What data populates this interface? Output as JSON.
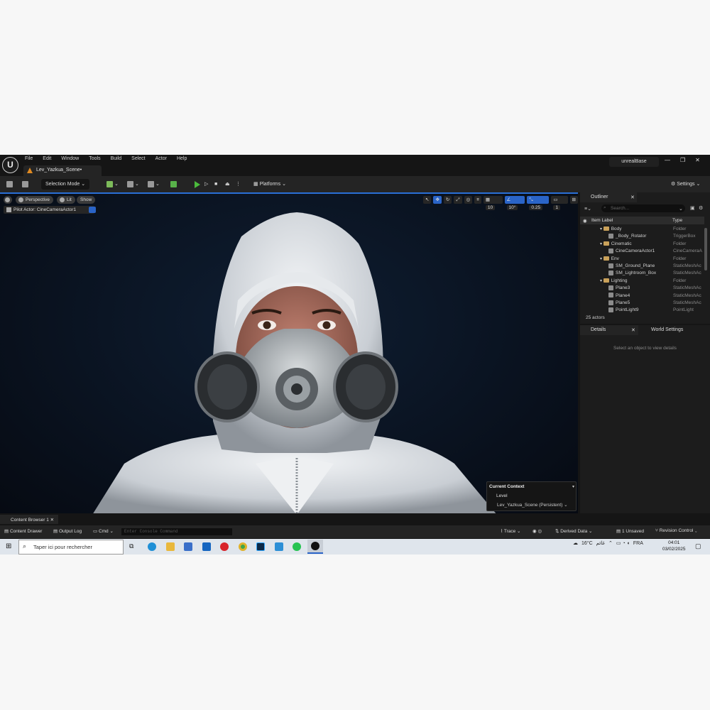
{
  "menu": [
    "File",
    "Edit",
    "Window",
    "Tools",
    "Build",
    "Select",
    "Actor",
    "Help"
  ],
  "doc_tab": "Lev_Yazkua_Scene•",
  "project": "unrealBase",
  "toolbar": {
    "mode": "Selection Mode",
    "platforms": "Platforms",
    "settings": "Settings"
  },
  "viewport": {
    "perspective": "Perspective",
    "lit": "Lit",
    "show": "Show",
    "pilot": "Pilot Actor: CineCameraActor1",
    "grid": "10",
    "angle": "10°",
    "scale": "0.25",
    "cam": "1"
  },
  "context": {
    "title": "Current Context",
    "level_label": "Level",
    "level_value": "Lev_Yazkua_Scene (Persistent)"
  },
  "outliner": {
    "tab": "Outliner",
    "search": "Search...",
    "col_label": "Item Label",
    "col_type": "Type",
    "rows": [
      {
        "label": "Body",
        "type": "Folder"
      },
      {
        "label": "_Body_Rotator",
        "type": "TriggerBox"
      },
      {
        "label": "Cinematic",
        "type": "Folder"
      },
      {
        "label": "CineCameraActor1",
        "type": "CineCameraA"
      },
      {
        "label": "Env",
        "type": "Folder"
      },
      {
        "label": "SM_Ground_Plane",
        "type": "StaticMeshAc"
      },
      {
        "label": "SM_Lightroom_Box",
        "type": "StaticMeshAc"
      },
      {
        "label": "Lighting",
        "type": "Folder"
      },
      {
        "label": "Plane3",
        "type": "StaticMeshAc"
      },
      {
        "label": "Plane4",
        "type": "StaticMeshAc"
      },
      {
        "label": "Plane5",
        "type": "StaticMeshAc"
      },
      {
        "label": "PointLight9",
        "type": "PointLight"
      }
    ],
    "count": "25 actors"
  },
  "details": {
    "tab": "Details",
    "tab2": "World Settings",
    "empty": "Select an object to view details"
  },
  "content_browser": "Content Browser 1",
  "status": {
    "drawer": "Content Drawer",
    "output": "Output Log",
    "cmd": "Cmd",
    "console": "Enter Console Command",
    "trace": "Trace",
    "derived": "Derived Data",
    "unsaved": "1 Unsaved",
    "revision": "Revision Control"
  },
  "taskbar": {
    "search": "Taper ici pour rechercher",
    "temp": "16°C",
    "weather": "غائم",
    "lang": "FRA",
    "time": "04:01",
    "date": "03/02/2025"
  }
}
